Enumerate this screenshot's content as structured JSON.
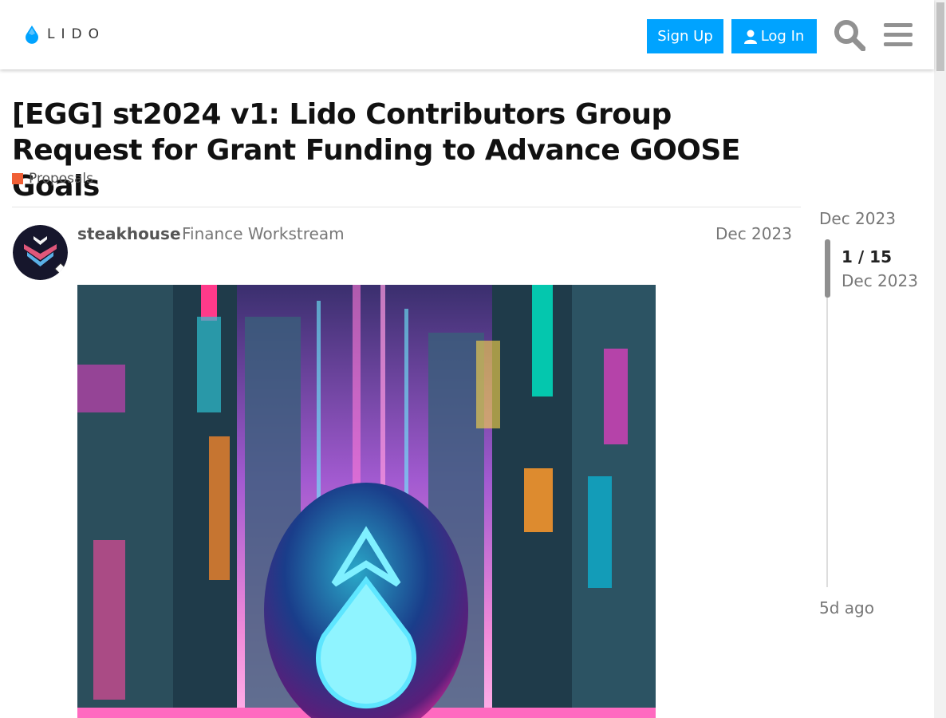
{
  "header": {
    "logo_text": "LIDO",
    "signup_label": "Sign Up",
    "login_label": "Log In",
    "accent_color": "#00a3ff"
  },
  "topic": {
    "title": "[EGG] st2024 v1: Lido Contributors Group Request for Grant Funding to Advance GOOSE Goals",
    "category": "Proposals",
    "category_color": "#f05f35"
  },
  "post": {
    "username": "steakhouse",
    "user_title": "Finance Workstream",
    "date": "Dec 2023"
  },
  "timeline": {
    "start_date": "Dec 2023",
    "position": "1 / 15",
    "position_date": "Dec 2023",
    "end_label": "5d ago"
  },
  "icons": [
    "lido-drop-icon",
    "user-icon",
    "search-icon",
    "hamburger-menu-icon"
  ]
}
